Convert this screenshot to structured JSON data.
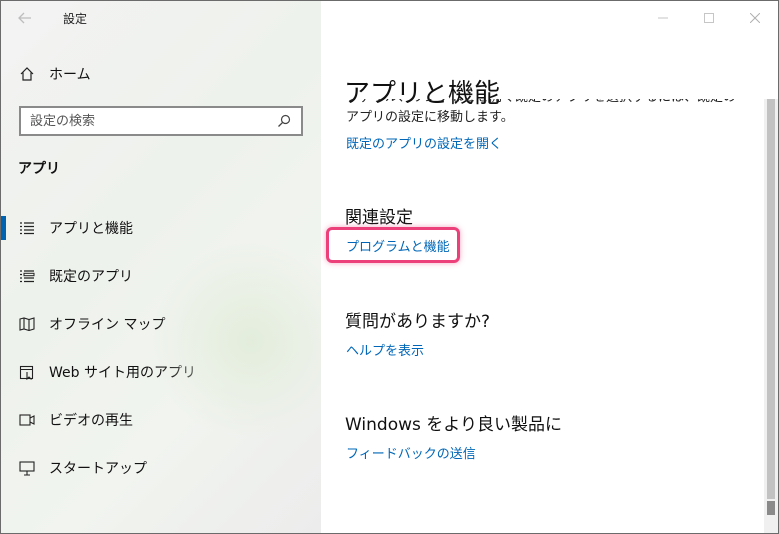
{
  "window": {
    "title": "設定"
  },
  "sidebar": {
    "home_label": "ホーム",
    "search_placeholder": "設定の検索",
    "section_title": "アプリ",
    "items": [
      {
        "label": "アプリと機能",
        "icon": "apps-features-icon",
        "active": true
      },
      {
        "label": "既定のアプリ",
        "icon": "default-apps-icon",
        "active": false
      },
      {
        "label": "オフライン マップ",
        "icon": "offline-maps-icon",
        "active": false
      },
      {
        "label": "Web サイト用のアプリ",
        "icon": "apps-for-websites-icon",
        "active": false
      },
      {
        "label": "ビデオの再生",
        "icon": "video-playback-icon",
        "active": false
      },
      {
        "label": "スタートアップ",
        "icon": "startup-icon",
        "active": false
      }
    ]
  },
  "content": {
    "title": "アプリと機能",
    "description": "ファイル、リンクなどを開く既定のアプリを選択するには、既定のアプリの設定に移動します。",
    "default_apps_link": "既定のアプリの設定を開く",
    "related_heading": "関連設定",
    "programs_link": "プログラムと機能",
    "question_heading": "質問がありますか?",
    "help_link": "ヘルプを表示",
    "windows_heading": "Windows をより良い製品に",
    "feedback_link": "フィードバックの送信"
  },
  "colors": {
    "accent": "#0067b8",
    "highlight": "#ec407a"
  }
}
